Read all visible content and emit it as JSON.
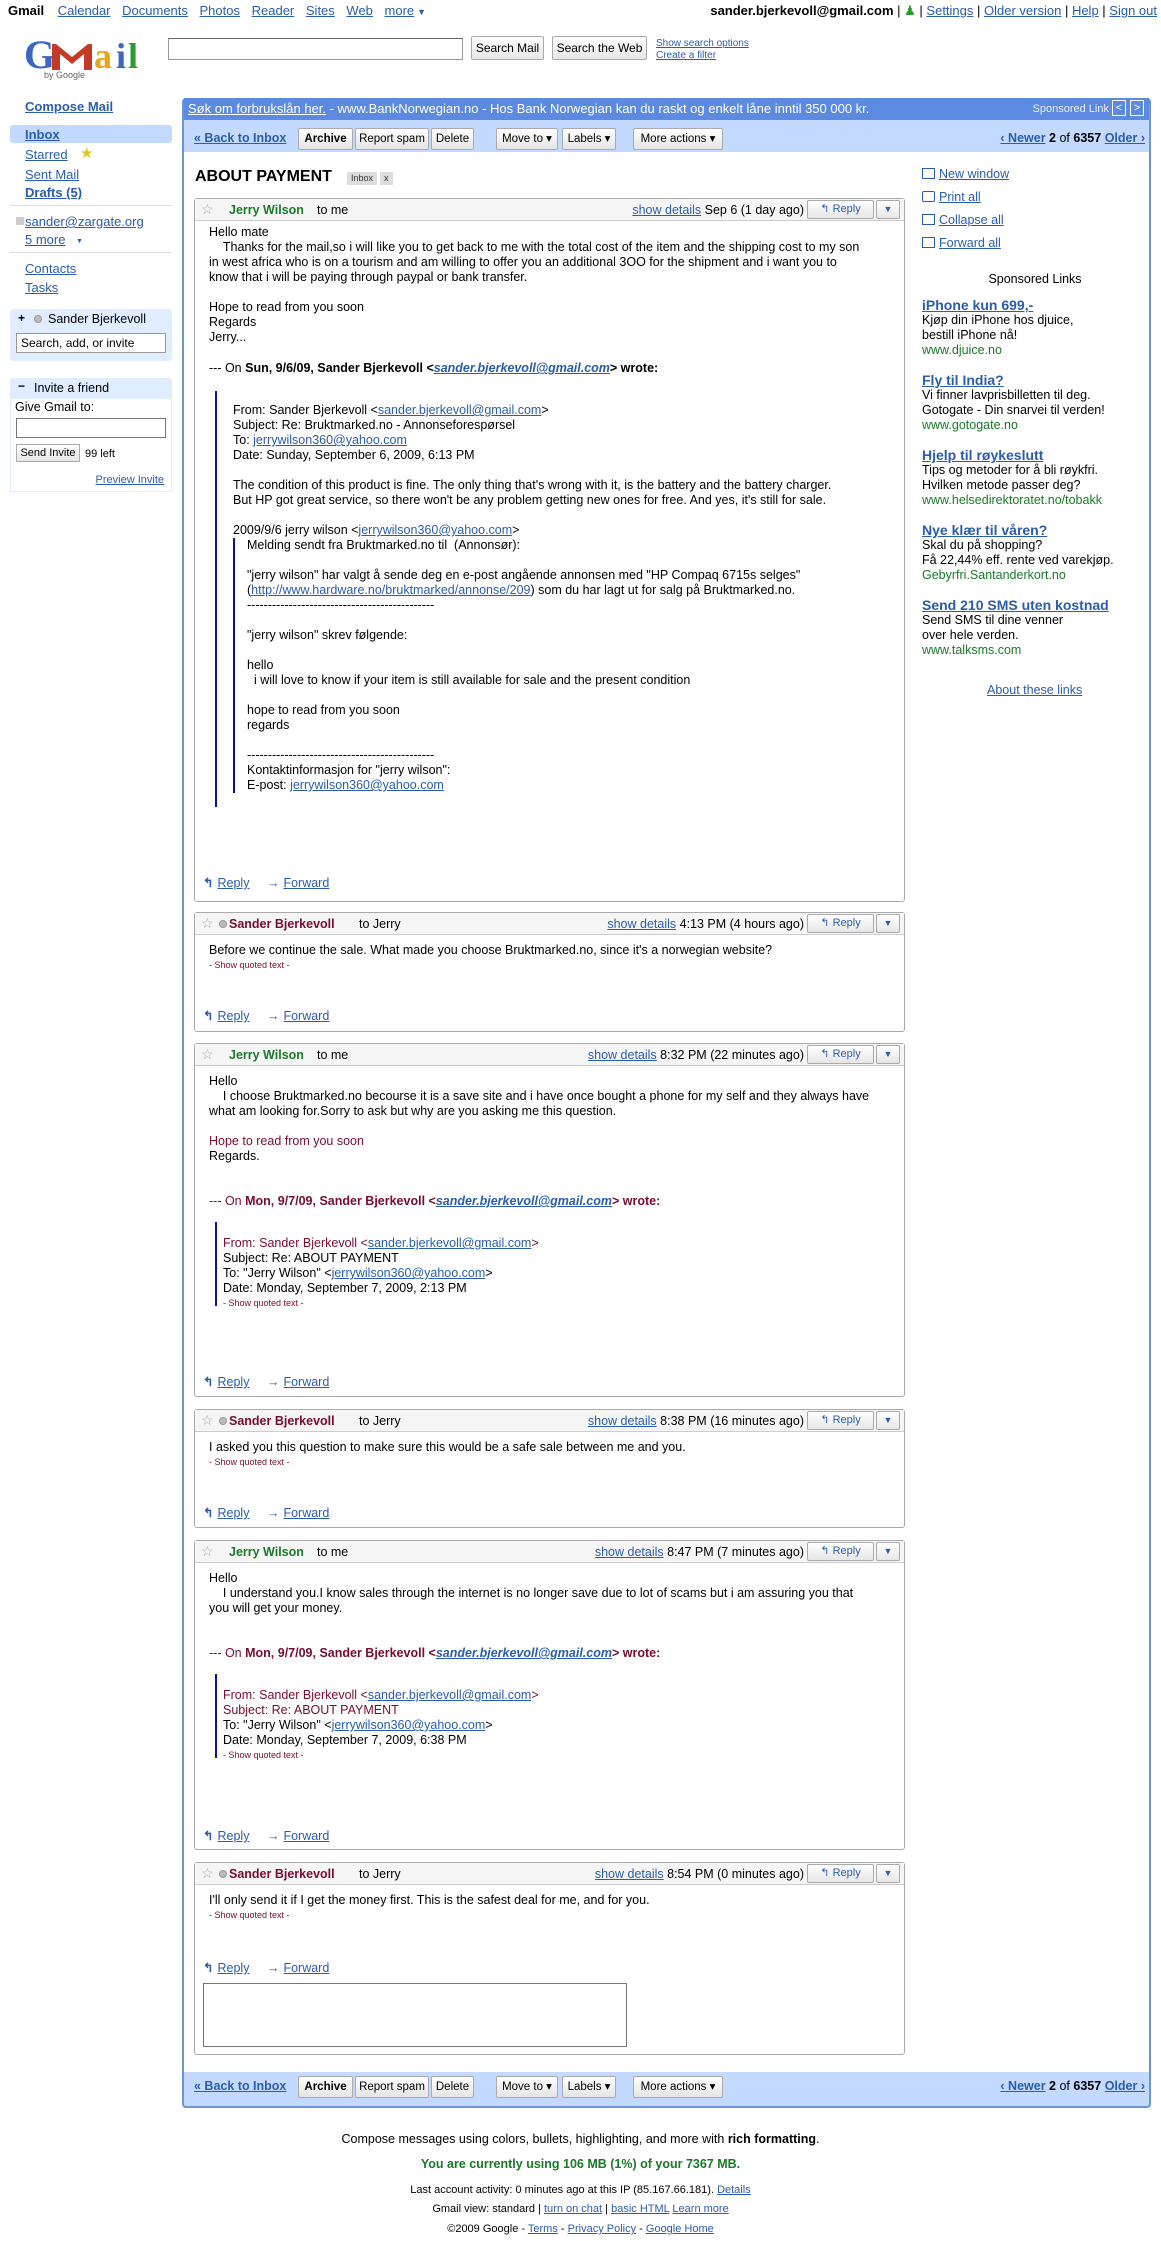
{
  "topnav": {
    "items": [
      "Gmail",
      "Calendar",
      "Documents",
      "Photos",
      "Reader",
      "Sites",
      "Web",
      "more"
    ],
    "account": "sander.bjerkevoll@gmail.com",
    "settings": "Settings",
    "older": "Older version",
    "help": "Help",
    "signout": "Sign out"
  },
  "header": {
    "search_mail": "Search Mail",
    "search_web": "Search the Web",
    "show_options": "Show search options",
    "create_filter": "Create a filter",
    "logo_by": "by Google"
  },
  "leftnav": {
    "compose": "Compose Mail",
    "inbox": "Inbox",
    "starred": "Starred",
    "sent": "Sent Mail",
    "drafts": "Drafts (5)",
    "zargate": "sander@zargate.org",
    "more": "5 more",
    "contacts": "Contacts",
    "tasks": "Tasks",
    "chat_name": "Sander Bjerkevoll",
    "chat_search": "Search, add, or invite",
    "invite_title": "Invite a friend",
    "give": "Give Gmail to:",
    "send_invite": "Send Invite",
    "left": "99 left",
    "preview": "Preview Invite"
  },
  "adbar": {
    "link": "Søk om forbrukslån her.",
    "text": " - www.BankNorwegian.no - Hos Bank Norwegian kan du raskt og enkelt låne inntil 350 000 kr.",
    "sponsored": "Sponsored Link"
  },
  "toolbar": {
    "back": "« Back to Inbox",
    "archive": "Archive",
    "spam": "Report spam",
    "delete": "Delete",
    "move": "Move to ▾",
    "labels": "Labels ▾",
    "more": "More actions ▾",
    "newer": "‹ Newer",
    "pos": "2",
    "of": "of",
    "total": "6357",
    "older": "Older ›"
  },
  "subject": "ABOUT PAYMENT",
  "label_inbox": "Inbox",
  "label_x": "x",
  "right": {
    "new_window": "New window",
    "print": "Print all",
    "collapse": "Collapse all",
    "forward": "Forward all",
    "sponsored": "Sponsored Links",
    "about": "About these links",
    "ads": [
      {
        "title": "iPhone kun 699,-",
        "text": "Kjøp din iPhone hos djuice,\nbestill iPhone nå!",
        "url": "www.djuice.no"
      },
      {
        "title": "Fly til India?",
        "text": "Vi finner lavprisbilletten til deg.\nGotogate - Din snarvei til verden!",
        "url": "www.gotogate.no"
      },
      {
        "title": "Hjelp til røykeslutt",
        "text": "Tips og metoder for å bli røykfri.\nHvilken metode passer deg?",
        "url": "www.helsedirektoratet.no/tobakk"
      },
      {
        "title": "Nye klær til våren?",
        "text": "Skal du på shopping?\nFå 22,44% eff. rente ved varekjøp.",
        "url": "Gebyrfri.Santanderkort.no"
      },
      {
        "title": "Send 210 SMS uten kostnad",
        "text": "Send SMS til dine venner\nover hele verden.",
        "url": "www.talksms.com"
      }
    ]
  },
  "messages": {
    "reply": "Reply",
    "forward": "Forward",
    "show_details": "show details",
    "reply_btn": "Reply",
    "show_quoted": "- Show quoted text -",
    "m1": {
      "sender": "Jerry Wilson",
      "to": "to me",
      "date": "Sep 6 (1 day ago)",
      "body": "Hello mate\n    Thanks for the mail,so i will like you to get back to me with the total cost of the item and the shipping cost to my son\nin west africa who is on a tourism and am willing to offer you an additional 3OO for the shipment and i want you to\nknow that i will be paying through paypal or bank transfer.\n\nHope to read from you soon\nRegards\nJerry...",
      "on": "--- On ",
      "on_date": "Sun, 9/6/09, Sander Bjerkevoll <",
      "on_email": "sander.bjerkevoll@gmail.com",
      "on_end": "> wrote:",
      "q_from": "From: Sander Bjerkevoll <",
      "q_from_email": "sander.bjerkevoll@gmail.com",
      "q_subject": "Subject: Re: Bruktmarked.no - Annonseforespørsel",
      "q_to": "To: ",
      "q_to_email": "jerrywilson360@yahoo.com",
      "q_date": "Date: Sunday, September 6, 2009, 6:13 PM",
      "q_body": "The condition of this product is fine. The only thing that's wrong with it, is the battery and the battery charger.\nBut HP got great service, so there won't be any problem getting new ones for free. And yes, it's still for sale.",
      "q2_head": "2009/9/6 jerry wilson <",
      "q2_email": "jerrywilson360@yahoo.com",
      "q2_end": ">",
      "q2_body": "Melding sendt fra Bruktmarked.no til  (Annonsør):\n\n\"jerry wilson\" har valgt å sende deg en e-post angående annonsen med \"HP Compaq 6715s selges\"\n(",
      "q2_link": "http://www.hardware.no/bruktmarked/annonse/209",
      "q2_after": ") som du har lagt ut for salg på Bruktmarked.no.\n---------------------------------------------\n\n\"jerry wilson\" skrev følgende:\n\nhello\n  i will love to know if your item is still available for sale and the present condition\n\nhope to read from you soon\nregards\n\n---------------------------------------------\nKontaktinformasjon for \"jerry wilson\":",
      "q2_epost": "E-post: ",
      "q2_epost_email": "jerrywilson360@yahoo.com"
    },
    "m2": {
      "sender": "Sander Bjerkevoll",
      "to": "to Jerry",
      "date": "4:13 PM (4 hours ago)",
      "body": "Before we continue the sale. What made you choose Bruktmarked.no, since it's a norwegian website?"
    },
    "m3": {
      "sender": "Jerry Wilson",
      "to": "to me",
      "date": "8:32 PM (22 minutes ago)",
      "body": "Hello\n    I choose Bruktmarked.no becourse it is a save site and i have once bought a phone for my self and they always have\nwhat am looking for.Sorry to ask but why are you asking me this question.",
      "hope": "Hope to read from you soon",
      "regards": "Regards.",
      "on": "--- On ",
      "on_date": "Mon, 9/7/09, Sander Bjerkevoll <",
      "on_email": "sander.bjerkevoll@gmail.com",
      "on_end": "> wrote:",
      "q_from": "From: Sander Bjerkevoll <",
      "q_from_email": "sander.bjerkevoll@gmail.com",
      "q_subject": "Subject: Re: ABOUT PAYMENT",
      "q_to": "To: \"Jerry Wilson\" <",
      "q_to_email": "jerrywilson360@yahoo.com",
      "q_date": "Date: Monday, September 7, 2009, 2:13 PM"
    },
    "m4": {
      "sender": "Sander Bjerkevoll",
      "to": "to Jerry",
      "date": "8:38 PM (16 minutes ago)",
      "body": "I asked you this question to make sure this would be a safe sale between me and you."
    },
    "m5": {
      "sender": "Jerry Wilson",
      "to": "to me",
      "date": "8:47 PM (7 minutes ago)",
      "body": "Hello\n    I understand you.I know sales through the internet is no longer save due to lot of scams but i am assuring you that\nyou will get your money.",
      "on": "--- On ",
      "on_date": "Mon, 9/7/09, Sander Bjerkevoll <",
      "on_email": "sander.bjerkevoll@gmail.com",
      "on_end": "> wrote:",
      "q_from": "From: Sander Bjerkevoll <",
      "q_from_email": "sander.bjerkevoll@gmail.com",
      "q_subject": "Subject: Re: ABOUT PAYMENT",
      "q_to": "To: \"Jerry Wilson\" <",
      "q_to_email": "jerrywilson360@yahoo.com",
      "q_date": "Date: Monday, September 7, 2009, 6:38 PM"
    },
    "m6": {
      "sender": "Sander Bjerkevoll",
      "to": "to Jerry",
      "date": "8:54 PM (0 minutes ago)",
      "body": "I'll only send it if I get the money first. This is the safest deal for me, and for you."
    }
  },
  "footer": {
    "compose": "Compose messages using colors, bullets, highlighting, and more with ",
    "rich": "rich formatting",
    "period": ".",
    "usage": "You are currently using 106 MB (1%) of your 7367 MB.",
    "activity": "Last account activity: 0 minutes ago at this IP (85.167.66.181).  ",
    "details": "Details",
    "view": "Gmail view: standard | ",
    "chat": "turn on chat",
    "sep": " | ",
    "basic": "basic HTML",
    "sep2": "  ",
    "learn": "Learn more",
    "copy": "©2009 Google - ",
    "terms": "Terms",
    "dash": " - ",
    "privacy": "Privacy Policy",
    "dash2": " - ",
    "home": "Google Home"
  }
}
